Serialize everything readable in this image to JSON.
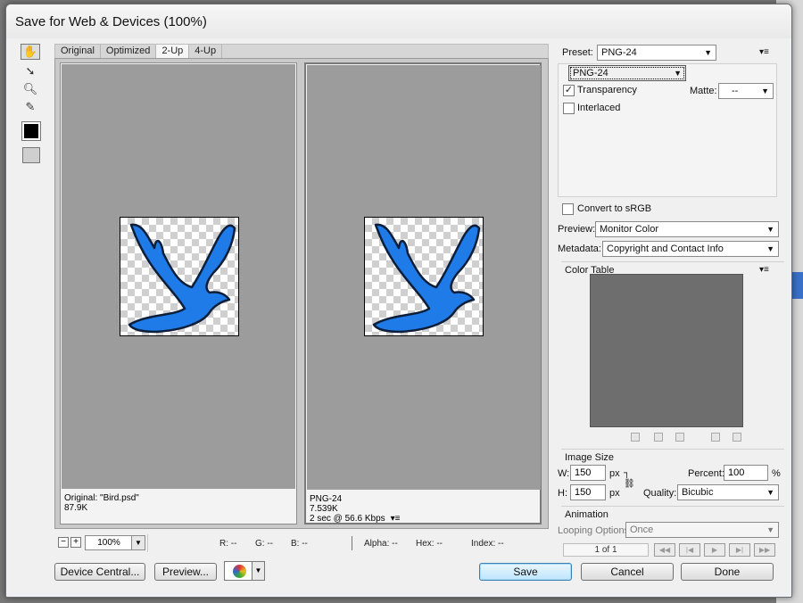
{
  "window": {
    "title": "Save for Web & Devices (100%)"
  },
  "tabs": [
    "Original",
    "Optimized",
    "2-Up",
    "4-Up"
  ],
  "active_tab": "2-Up",
  "panes": [
    {
      "line1": "Original: \"Bird.psd\"",
      "line2": "87.9K",
      "line3": ""
    },
    {
      "line1": "PNG-24",
      "line2": "7.539K",
      "line3": "2 sec @ 56.6 Kbps"
    }
  ],
  "status": {
    "zoom": "100%",
    "r": "R: --",
    "g": "G: --",
    "b": "B: --",
    "alpha": "Alpha: --",
    "hex": "Hex: --",
    "index": "Index: --"
  },
  "buttons": {
    "device_central": "Device Central...",
    "preview": "Preview...",
    "save": "Save",
    "cancel": "Cancel",
    "done": "Done"
  },
  "settings": {
    "preset_label": "Preset:",
    "preset_value": "PNG-24",
    "format_value": "PNG-24",
    "transparency_label": "Transparency",
    "transparency_checked": true,
    "interlaced_label": "Interlaced",
    "interlaced_checked": false,
    "matte_label": "Matte:",
    "matte_value": "--",
    "convert_srgb_label": "Convert to sRGB",
    "preview_label": "Preview:",
    "preview_value": "Monitor Color",
    "metadata_label": "Metadata:",
    "metadata_value": "Copyright and Contact Info"
  },
  "color_table": {
    "title": "Color Table"
  },
  "image_size": {
    "title": "Image Size",
    "w_label": "W:",
    "w_value": "150",
    "w_unit": "px",
    "h_label": "H:",
    "h_value": "150",
    "h_unit": "px",
    "percent_label": "Percent:",
    "percent_value": "100",
    "percent_unit": "%",
    "quality_label": "Quality:",
    "quality_value": "Bicubic"
  },
  "animation": {
    "title": "Animation",
    "looping_label": "Looping Options:",
    "looping_value": "Once",
    "frame_count": "1 of 1"
  },
  "colors": {
    "bird": "#1f7be8",
    "accent": "#3c7fb1"
  }
}
